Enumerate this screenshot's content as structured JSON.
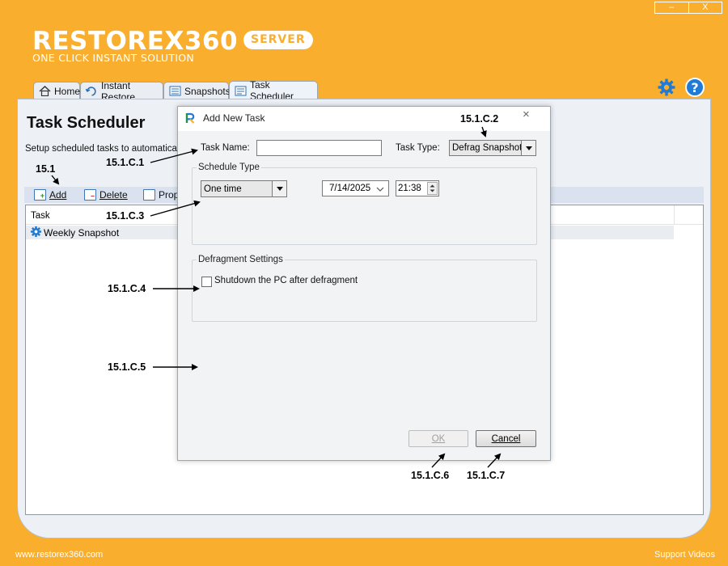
{
  "window": {
    "minimize_label": "–",
    "close_label": "X"
  },
  "brand": {
    "name": "RESTOREX360",
    "badge": "SERVER",
    "tagline": "ONE CLICK INSTANT SOLUTION"
  },
  "tabs": [
    {
      "label": "Home",
      "icon": "home-icon"
    },
    {
      "label": "Instant Restore",
      "icon": "restore-icon"
    },
    {
      "label": "Snapshots",
      "icon": "snapshots-icon"
    },
    {
      "label": "Task Scheduler",
      "icon": "scheduler-icon",
      "active": true
    }
  ],
  "page": {
    "title": "Task Scheduler",
    "description": "Setup scheduled tasks to automatically"
  },
  "toolbar": {
    "add_label": "Add",
    "delete_label": "Delete",
    "properties_label": "Prop"
  },
  "grid": {
    "columns": [
      "Task"
    ],
    "rows": [
      {
        "name": "Weekly Snapshot"
      }
    ]
  },
  "footer": {
    "website": "www.restorex360.com",
    "support": "Support Videos"
  },
  "dialog": {
    "title": "Add New Task",
    "close_label": "×",
    "task_name_label": "Task Name:",
    "task_name_value": "",
    "task_type_label": "Task Type:",
    "task_type_value": "Defrag Snapshots",
    "schedule_group_title": "Schedule Type",
    "schedule_type_value": "One time",
    "date_value": "7/14/2025",
    "time_value": "21:38",
    "defrag_group_title": "Defragment Settings",
    "shutdown_label": "Shutdown the PC after defragment",
    "shutdown_checked": false,
    "ok_label": "OK",
    "cancel_label": "Cancel"
  },
  "annotations": {
    "a1": "15.1",
    "c1": "15.1.C.1",
    "c2": "15.1.C.2",
    "c3": "15.1.C.3",
    "c4": "15.1.C.4",
    "c5": "15.1.C.5",
    "c6": "15.1.C.6",
    "c7": "15.1.C.7"
  },
  "colors": {
    "brand_orange": "#f9ae2d",
    "icon_blue": "#1f7bd6",
    "panel_bg": "#edf1f6"
  }
}
